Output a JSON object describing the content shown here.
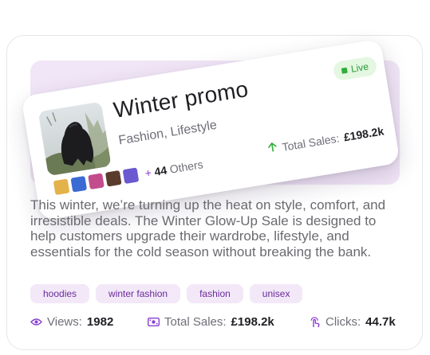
{
  "promo": {
    "title": "Winter promo",
    "category": "Fashion, Lifestyle",
    "status": "Live",
    "sales_label": "Total Sales:",
    "sales_value": "£198.2k",
    "others_plus": "+",
    "others_count": "44",
    "others_label": "Others",
    "image_icon": "gorilla-photo",
    "avatar_colors": [
      "#e3b24a",
      "#3a6ad4",
      "#c24c8c",
      "#5a3c2c",
      "#6b59d1"
    ]
  },
  "description": "This winter, we’re turning up the heat on style, comfort, and irresistible deals. The Winter Glow-Up Sale is designed to help customers upgrade their wardrobe, lifestyle, and essentials for the cold season without breaking the bank.",
  "tags": [
    "hoodies",
    "winter fashion",
    "fashion",
    "unisex"
  ],
  "stats": {
    "views_label": "Views:",
    "views_value": "1982",
    "sales_label": "Total Sales:",
    "sales_value": "£198.2k",
    "clicks_label": "Clicks:",
    "clicks_value": "44.7k"
  },
  "colors": {
    "accent": "#8a3fd1",
    "tag_bg": "#f2e8f8",
    "live_bg": "#e3f7e1",
    "live_text": "#2d9a35"
  }
}
